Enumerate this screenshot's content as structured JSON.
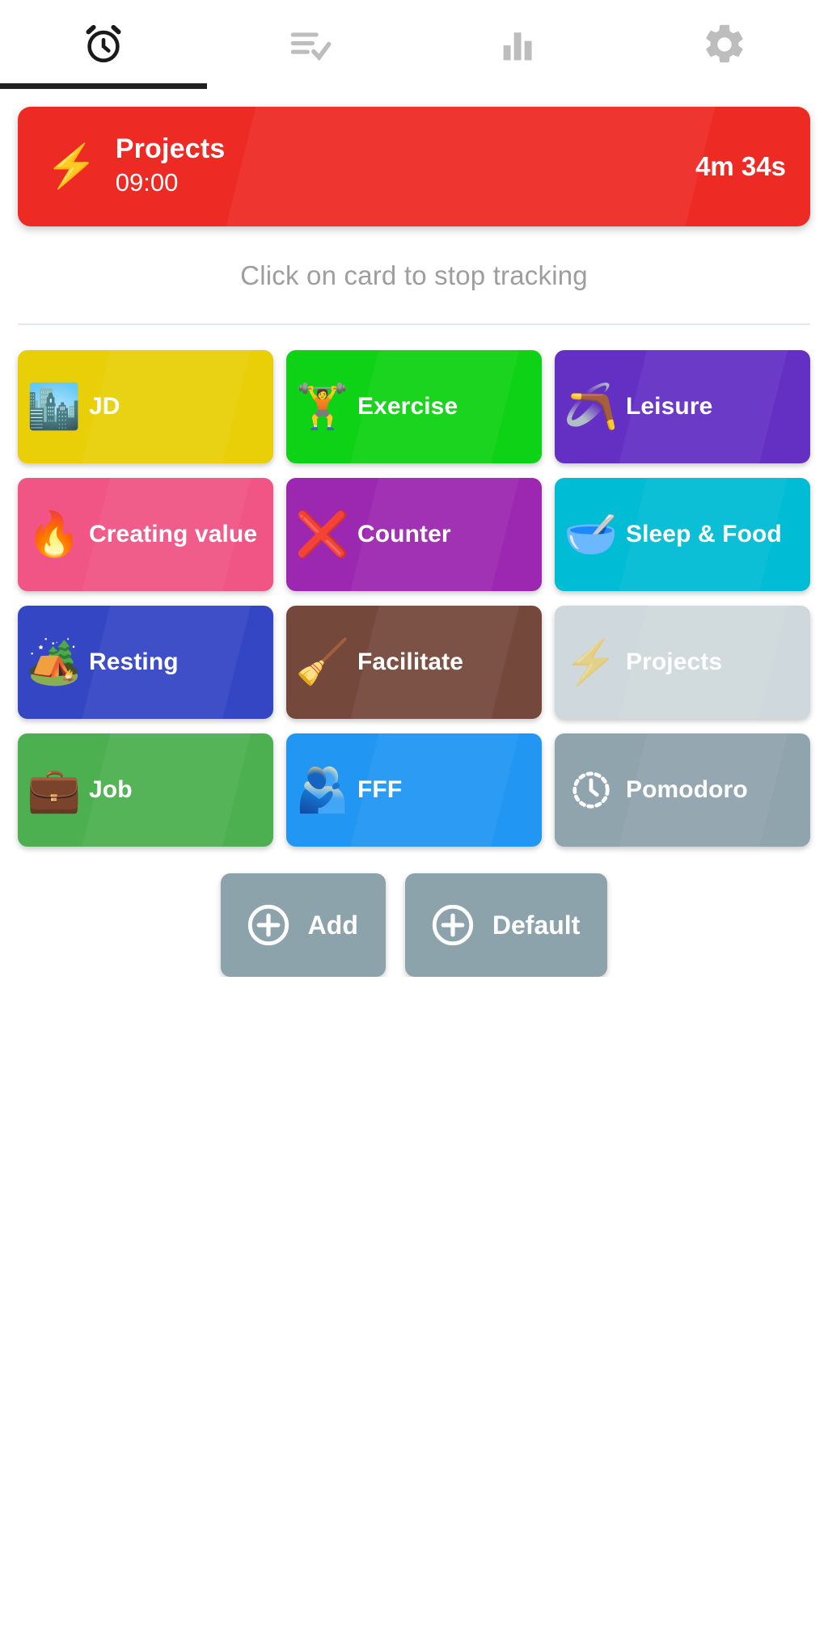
{
  "theme": {
    "background": "#ffffff",
    "active_tab_indicator": "#212121",
    "inactive_icon": "#bdbdbd",
    "active_icon": "#1a1a1a",
    "hint_text_color": "#9e9e9e",
    "divider_color": "#e4e7ea",
    "action_button_color": "#8ca3ab"
  },
  "tabs": [
    {
      "id": "tab-timer",
      "icon": "alarm-clock-icon",
      "active": true
    },
    {
      "id": "tab-records",
      "icon": "checklist-icon",
      "active": false
    },
    {
      "id": "tab-stats",
      "icon": "bar-chart-icon",
      "active": false
    },
    {
      "id": "tab-settings",
      "icon": "gear-icon",
      "active": false
    }
  ],
  "running": {
    "name": "Projects",
    "start_time": "09:00",
    "duration": "4m 34s",
    "icon": "high-voltage-emoji",
    "icon_glyph": "⚡",
    "color": "#ee2a25"
  },
  "hint": "Click on card to stop tracking",
  "activities": [
    {
      "label": "JD",
      "color": "#e8cf07",
      "icon": "cityscape-emoji",
      "icon_glyph": "🏙️",
      "faded": false
    },
    {
      "label": "Exercise",
      "color": "#0ed215",
      "icon": "weightlifter-emoji",
      "icon_glyph": "🏋️",
      "faded": false
    },
    {
      "label": "Leisure",
      "color": "#6430c4",
      "icon": "boomerang-emoji",
      "icon_glyph": "🪃",
      "faded": false
    },
    {
      "label": "Creating value",
      "color": "#f05585",
      "icon": "fire-emoji",
      "icon_glyph": "🔥",
      "faded": false
    },
    {
      "label": "Counter",
      "color": "#9c27b0",
      "icon": "cross-mark-emoji",
      "icon_glyph": "❌",
      "faded": false
    },
    {
      "label": "Sleep & Food",
      "color": "#00bcd4",
      "icon": "bowl-with-spoon-emoji",
      "icon_glyph": "🥣",
      "faded": false
    },
    {
      "label": "Resting",
      "color": "#3446c4",
      "icon": "camping-emoji",
      "icon_glyph": "🏕️",
      "faded": false
    },
    {
      "label": "Facilitate",
      "color": "#74493c",
      "icon": "broom-emoji",
      "icon_glyph": "🧹",
      "faded": false
    },
    {
      "label": "Projects",
      "color": "#cfd8dc",
      "icon": "high-voltage-emoji",
      "icon_glyph": "⚡",
      "faded": true
    },
    {
      "label": "Job",
      "color": "#4caf50",
      "icon": "briefcase-emoji",
      "icon_glyph": "💼",
      "faded": false
    },
    {
      "label": "FFF",
      "color": "#2196f3",
      "icon": "people-hugging-emoji",
      "icon_glyph": "🫂",
      "faded": false
    },
    {
      "label": "Pomodoro",
      "color": "#90a4ae",
      "icon": "dashed-clock-icon",
      "icon_glyph": "",
      "faded": false
    }
  ],
  "actions": [
    {
      "label": "Add",
      "icon": "plus-circle-icon",
      "color": "#8ca3ab"
    },
    {
      "label": "Default",
      "icon": "plus-circle-icon",
      "color": "#8ca3ab"
    }
  ]
}
